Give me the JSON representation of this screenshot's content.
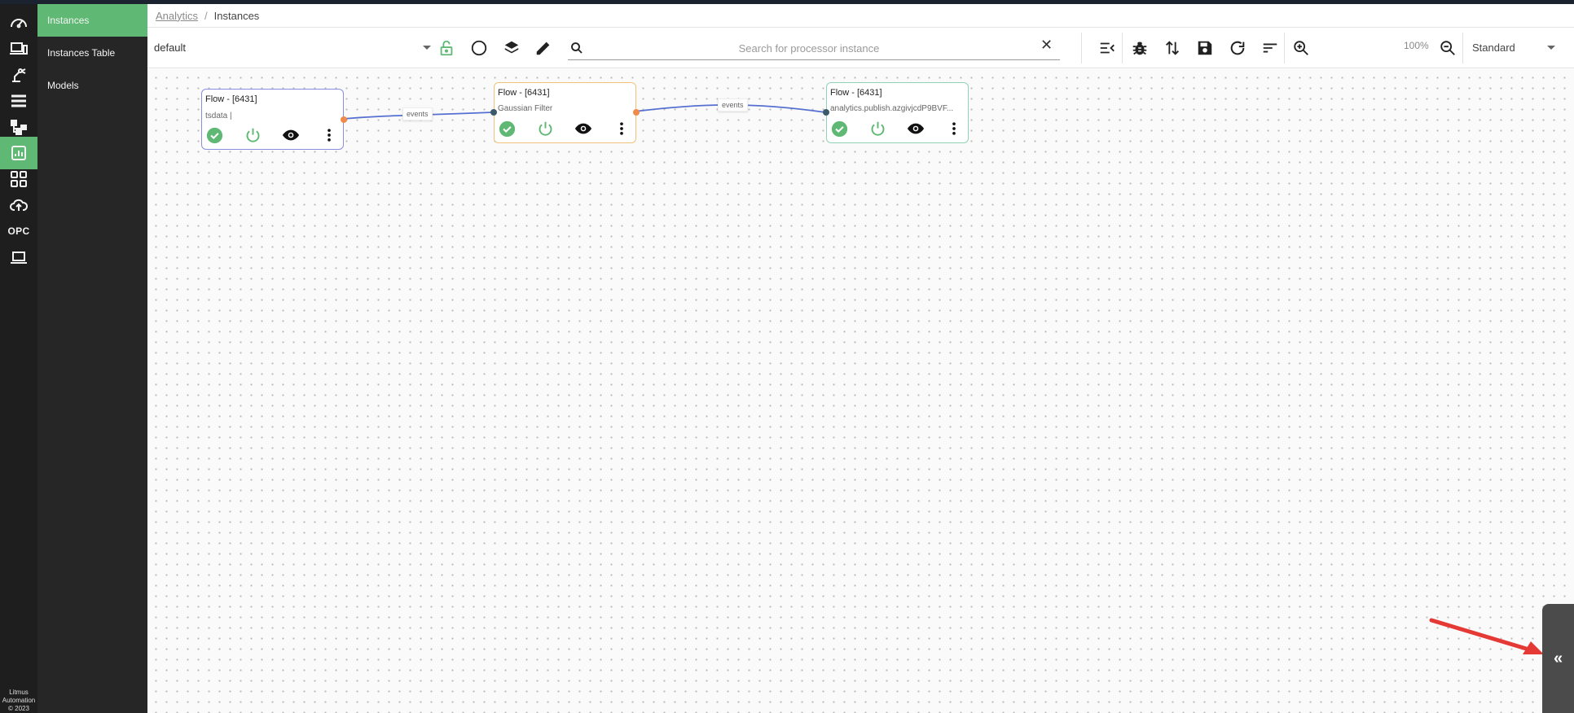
{
  "breadcrumb": {
    "parent": "Analytics",
    "separator": "/",
    "current": "Instances"
  },
  "rail": {
    "items": [
      {
        "name": "dashboard-icon"
      },
      {
        "name": "devices-icon"
      },
      {
        "name": "robot-arm-icon"
      },
      {
        "name": "list-icon"
      },
      {
        "name": "flow-icon"
      },
      {
        "name": "analytics-icon",
        "active": true
      },
      {
        "name": "apps-grid-icon"
      },
      {
        "name": "cloud-upload-icon"
      },
      {
        "name": "opc-label",
        "text": "OPC"
      },
      {
        "name": "laptop-icon"
      }
    ],
    "footer": [
      "Litmus",
      "Automation",
      "© 2023"
    ]
  },
  "subnav": {
    "items": [
      {
        "label": "Instances",
        "active": true
      },
      {
        "label": "Instances Table"
      },
      {
        "label": "Models"
      }
    ]
  },
  "toolbar": {
    "flow_select": "default",
    "search_placeholder": "Search for processor instance",
    "clear_icon": "✕",
    "zoom_level": "100%",
    "view_select": "Standard",
    "icons": [
      "lock-open-icon",
      "circle-icon",
      "layers-icon",
      "edit-pencil-icon",
      "search-icon",
      "collapse-menu-icon",
      "debug-bug-icon",
      "sort-arrows-icon",
      "save-icon",
      "refresh-icon",
      "filter-lines-icon",
      "zoom-in-icon",
      "zoom-out-icon"
    ]
  },
  "nodes": [
    {
      "title": "Flow - [6431]",
      "subtitle": "tsdata |",
      "border": "#8a8ee0"
    },
    {
      "title": "Flow - [6431]",
      "subtitle": "Gaussian Filter",
      "border": "#f3c27a"
    },
    {
      "title": "Flow - [6431]",
      "subtitle": "analytics.publish.azgivjcdP9BVF...",
      "border": "#8fd3b4"
    }
  ],
  "edges": [
    {
      "label": "events"
    },
    {
      "label": "events"
    }
  ],
  "colors": {
    "accent_green": "#5fb974",
    "edge_blue": "#5570d0",
    "port_out": "#f08a4b",
    "port_in": "#3b5a6a",
    "annotation_arrow": "#e53935"
  },
  "collapse_tab": {
    "glyph": "«"
  }
}
